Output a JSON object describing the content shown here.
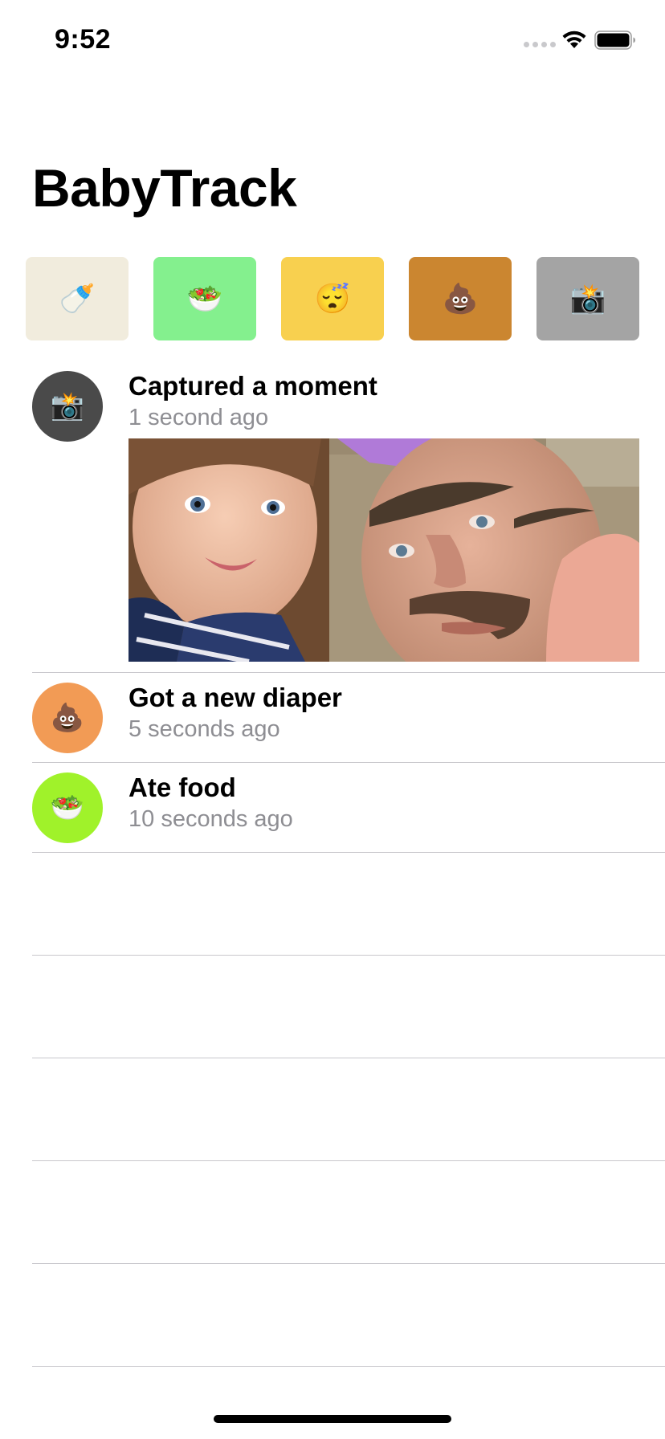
{
  "status_bar": {
    "time": "9:52"
  },
  "title": "BabyTrack",
  "quick_actions": [
    {
      "icon": "baby-bottle-icon",
      "glyph": "🍼",
      "color": "#f1ecdd"
    },
    {
      "icon": "salad-icon",
      "glyph": "🥗",
      "color": "#84f08e"
    },
    {
      "icon": "sleepy-face-icon",
      "glyph": "😴",
      "color": "#f8d04f"
    },
    {
      "icon": "poop-icon",
      "glyph": "💩",
      "color": "#cb8630"
    },
    {
      "icon": "camera-flash-icon",
      "glyph": "📸",
      "color": "#a4a4a4"
    }
  ],
  "feed": [
    {
      "title": "Captured a moment",
      "time": "1 second ago",
      "icon": "camera-flash-icon",
      "glyph": "📸",
      "avatar_color": "#4a4a4a",
      "has_photo": true
    },
    {
      "title": "Got a new diaper",
      "time": "5 seconds ago",
      "icon": "poop-icon",
      "glyph": "💩",
      "avatar_color": "#f29b55"
    },
    {
      "title": "Ate food",
      "time": "10 seconds ago",
      "icon": "salad-icon",
      "glyph": "🥗",
      "avatar_color": "#a0f22a"
    }
  ],
  "empty_rows": 5
}
